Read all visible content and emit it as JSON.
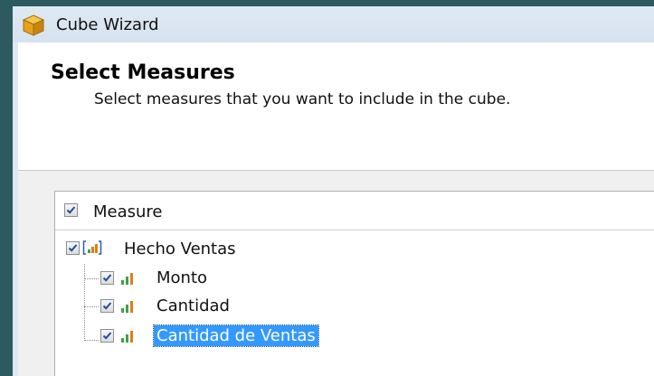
{
  "window": {
    "title": "Cube Wizard"
  },
  "header": {
    "title": "Select Measures",
    "subtitle": "Select measures that you want to include in the cube."
  },
  "tree": {
    "column_header": "Measure",
    "column_checked": true,
    "group": {
      "label": "Hecho Ventas",
      "checked": true,
      "items": [
        {
          "label": "Monto",
          "checked": true,
          "selected": false
        },
        {
          "label": "Cantidad",
          "checked": true,
          "selected": false
        },
        {
          "label": "Cantidad de Ventas",
          "checked": true,
          "selected": true
        }
      ]
    }
  },
  "colors": {
    "selection": "#3399ff",
    "bar_green": "#3fa14a",
    "bar_orange": "#e27d19",
    "desktop": "#2c5a5f"
  },
  "icons": [
    "cube-icon",
    "measure-group-icon",
    "measure-icon",
    "checkbox-checked-icon"
  ]
}
